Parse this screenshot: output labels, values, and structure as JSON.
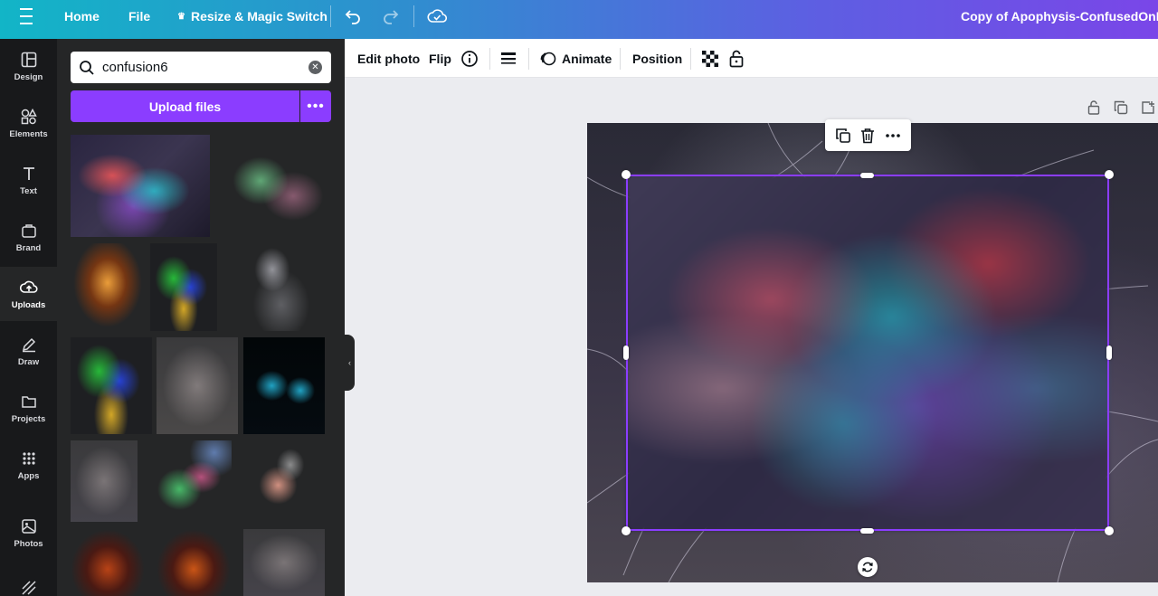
{
  "topbar": {
    "home": "Home",
    "file": "File",
    "resize": "Resize & Magic Switch",
    "title": "Copy of Apophysis-ConfusedOnMan"
  },
  "rail": {
    "items": [
      {
        "label": "Design",
        "icon": "layout-icon"
      },
      {
        "label": "Elements",
        "icon": "shapes-icon"
      },
      {
        "label": "Text",
        "icon": "text-icon"
      },
      {
        "label": "Brand",
        "icon": "brand-icon"
      },
      {
        "label": "Uploads",
        "icon": "cloud-upload-icon"
      },
      {
        "label": "Draw",
        "icon": "pen-icon"
      },
      {
        "label": "Projects",
        "icon": "folder-icon"
      },
      {
        "label": "Apps",
        "icon": "grid-icon"
      },
      {
        "label": "Photos",
        "icon": "photo-icon"
      }
    ],
    "active": "Uploads"
  },
  "panel": {
    "search_value": "confusion6",
    "upload_label": "Upload files",
    "more_label": "•••"
  },
  "toolbar": {
    "edit_photo": "Edit photo",
    "flip": "Flip",
    "animate": "Animate",
    "position": "Position"
  },
  "colors": {
    "accent": "#8b3dff",
    "rail_bg": "#18191b",
    "panel_bg": "#252627"
  }
}
